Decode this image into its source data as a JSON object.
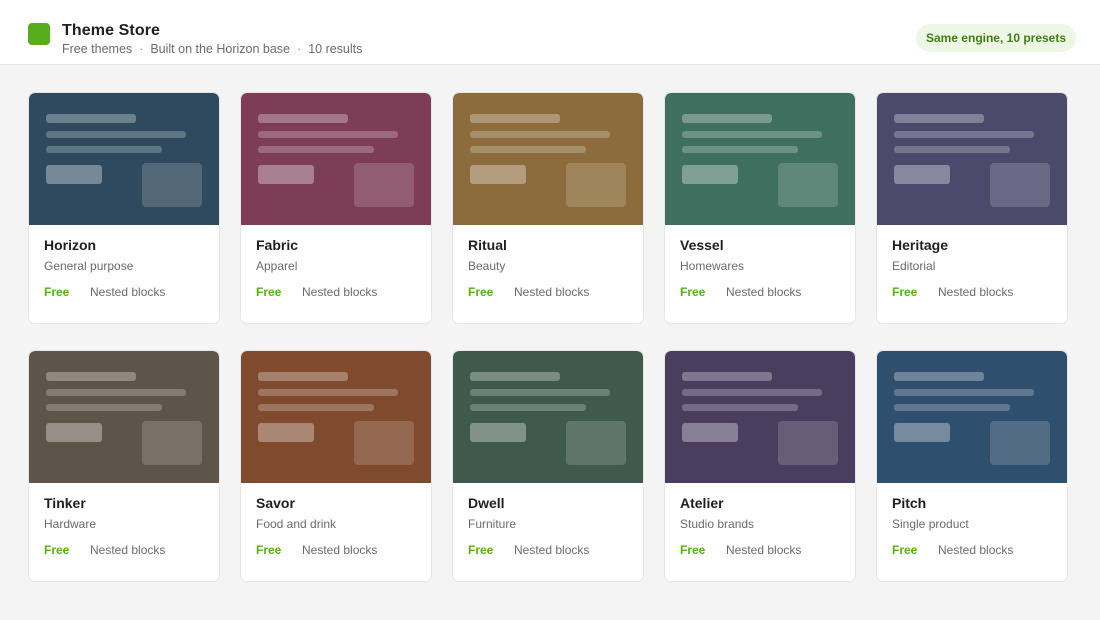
{
  "header": {
    "title": "Theme Store",
    "subtitle_parts": [
      "Free themes",
      "Built on the Horizon base",
      "10 results"
    ],
    "badge": "Same engine, 10 presets",
    "logo_color": "#58ad1c"
  },
  "colors": {
    "accent": "#58ad1c",
    "badge_bg": "#eef7e6",
    "badge_text": "#3f7d14"
  },
  "themes": [
    {
      "name": "Horizon",
      "category": "General purpose",
      "price": "Free",
      "feature": "Nested blocks",
      "color": "#2f4a5e"
    },
    {
      "name": "Fabric",
      "category": "Apparel",
      "price": "Free",
      "feature": "Nested blocks",
      "color": "#7c3d55"
    },
    {
      "name": "Ritual",
      "category": "Beauty",
      "price": "Free",
      "feature": "Nested blocks",
      "color": "#8c6b3c"
    },
    {
      "name": "Vessel",
      "category": "Homewares",
      "price": "Free",
      "feature": "Nested blocks",
      "color": "#3f6f5f"
    },
    {
      "name": "Heritage",
      "category": "Editorial",
      "price": "Free",
      "feature": "Nested blocks",
      "color": "#4c4a6c"
    },
    {
      "name": "Tinker",
      "category": "Hardware",
      "price": "Free",
      "feature": "Nested blocks",
      "color": "#5e554a"
    },
    {
      "name": "Savor",
      "category": "Food and drink",
      "price": "Free",
      "feature": "Nested blocks",
      "color": "#7f4a2d"
    },
    {
      "name": "Dwell",
      "category": "Furniture",
      "price": "Free",
      "feature": "Nested blocks",
      "color": "#3f5a4c"
    },
    {
      "name": "Atelier",
      "category": "Studio brands",
      "price": "Free",
      "feature": "Nested blocks",
      "color": "#4a3d5e"
    },
    {
      "name": "Pitch",
      "category": "Single product",
      "price": "Free",
      "feature": "Nested blocks",
      "color": "#2f4f6e"
    }
  ]
}
